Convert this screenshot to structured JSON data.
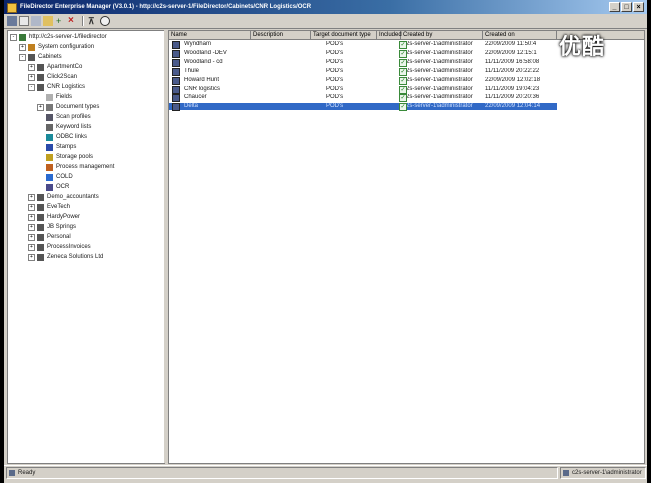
{
  "window": {
    "title": "FileDirector Enterprise Manager (V3.0.1) - http://c2s-server-1/FileDirector/Cabinets/CNR Logistics/OCR"
  },
  "watermark": "优酷",
  "tree": [
    {
      "id": "root",
      "label": "http://c2s-server-1/filedirector",
      "level": 0,
      "expander": "-",
      "icon": "server-icon",
      "color": "#3a7a3a"
    },
    {
      "id": "system-config",
      "label": "System configuration",
      "level": 1,
      "expander": "+",
      "icon": "config-icon",
      "color": "#c08020"
    },
    {
      "id": "cabinets",
      "label": "Cabinets",
      "level": 1,
      "expander": "-",
      "icon": "cabinet-icon",
      "color": "#555"
    },
    {
      "id": "apartmentco",
      "label": "ApartmentCo",
      "level": 2,
      "expander": "+",
      "icon": "cabinet-icon",
      "color": "#555"
    },
    {
      "id": "click2scan",
      "label": "Click2Scan",
      "level": 2,
      "expander": "+",
      "icon": "cabinet-icon",
      "color": "#555"
    },
    {
      "id": "cnr-logistics",
      "label": "CNR Logistics",
      "level": 2,
      "expander": "-",
      "icon": "cabinet-icon",
      "color": "#555"
    },
    {
      "id": "fields",
      "label": "Fields",
      "level": 3,
      "expander": "",
      "icon": "fields-icon",
      "color": "#b0b0b0"
    },
    {
      "id": "document-types",
      "label": "Document types",
      "level": 3,
      "expander": "+",
      "icon": "doctype-icon",
      "color": "#777"
    },
    {
      "id": "scan-profiles",
      "label": "Scan profiles",
      "level": 3,
      "expander": "",
      "icon": "scanner-icon",
      "color": "#556"
    },
    {
      "id": "keyword-lists",
      "label": "Keyword lists",
      "level": 3,
      "expander": "",
      "icon": "keyword-icon",
      "color": "#666"
    },
    {
      "id": "odbc-links",
      "label": "ODBC links",
      "level": 3,
      "expander": "",
      "icon": "odbc-icon",
      "color": "#1a8a9a"
    },
    {
      "id": "stamps",
      "label": "Stamps",
      "level": 3,
      "expander": "",
      "icon": "stamp-icon",
      "color": "#2a4aaa"
    },
    {
      "id": "storage-pools",
      "label": "Storage pools",
      "level": 3,
      "expander": "",
      "icon": "storage-icon",
      "color": "#c0a020"
    },
    {
      "id": "process-management",
      "label": "Process management",
      "level": 3,
      "expander": "",
      "icon": "process-icon",
      "color": "#c06020"
    },
    {
      "id": "cold",
      "label": "COLD",
      "level": 3,
      "expander": "",
      "icon": "cold-icon",
      "color": "#2a6ad0"
    },
    {
      "id": "ocr",
      "label": "OCR",
      "level": 3,
      "expander": "",
      "icon": "ocr-icon",
      "color": "#4a4a8a"
    },
    {
      "id": "demo-accountants",
      "label": "Demo_accountants",
      "level": 2,
      "expander": "+",
      "icon": "cabinet-icon",
      "color": "#555"
    },
    {
      "id": "evetech",
      "label": "EveTech",
      "level": 2,
      "expander": "+",
      "icon": "cabinet-icon",
      "color": "#555"
    },
    {
      "id": "hardypower",
      "label": "HardyPower",
      "level": 2,
      "expander": "+",
      "icon": "cabinet-icon",
      "color": "#555"
    },
    {
      "id": "jb-springs",
      "label": "JB Springs",
      "level": 2,
      "expander": "+",
      "icon": "cabinet-icon",
      "color": "#555"
    },
    {
      "id": "personal",
      "label": "Personal",
      "level": 2,
      "expander": "+",
      "icon": "cabinet-icon",
      "color": "#555"
    },
    {
      "id": "processinvoices",
      "label": "ProcessInvoices",
      "level": 2,
      "expander": "+",
      "icon": "cabinet-icon",
      "color": "#555"
    },
    {
      "id": "zeneca-solutions",
      "label": "Zeneca Solutions Ltd",
      "level": 2,
      "expander": "+",
      "icon": "cabinet-icon",
      "color": "#555"
    }
  ],
  "list": {
    "columns": [
      "Name",
      "Description",
      "Target document type",
      "Included",
      "Created by",
      "Created on"
    ],
    "rows": [
      {
        "name": "Wyndham",
        "description": "",
        "target": "POD's",
        "included": "✓",
        "created_by": "c2s-server-1\\administrator",
        "created_on": "22/09/2009 11:50:4",
        "selected": false
      },
      {
        "name": "Woodland -DEV",
        "description": "",
        "target": "POD's",
        "included": "✓",
        "created_by": "c2s-server-1\\administrator",
        "created_on": "22/09/2009 12:15:1",
        "selected": false
      },
      {
        "name": "Woodland - cd",
        "description": "",
        "target": "POD's",
        "included": "✓",
        "created_by": "c2s-server-1\\administrator",
        "created_on": "11/11/2009 16:58:08",
        "selected": false
      },
      {
        "name": "Thule",
        "description": "",
        "target": "POD's",
        "included": "✓",
        "created_by": "c2s-server-1\\administrator",
        "created_on": "11/11/2009 20:22:22",
        "selected": false
      },
      {
        "name": "Howard Hunt",
        "description": "",
        "target": "POD's",
        "included": "✓",
        "created_by": "c2s-server-1\\administrator",
        "created_on": "22/09/2009 12:02:18",
        "selected": false
      },
      {
        "name": "CNR logistics",
        "description": "",
        "target": "POD's",
        "included": "✓",
        "created_by": "c2s-server-1\\administrator",
        "created_on": "11/11/2009 19:04:23",
        "selected": false
      },
      {
        "name": "Chaucer",
        "description": "",
        "target": "POD's",
        "included": "✓",
        "created_by": "c2s-server-1\\administrator",
        "created_on": "11/11/2009 20:20:36",
        "selected": false
      },
      {
        "name": "Delta",
        "description": "",
        "target": "POD's",
        "included": "✓",
        "created_by": "c2s-server-1\\administrator",
        "created_on": "22/09/2009 12:04:14",
        "selected": true
      }
    ]
  },
  "status": {
    "left": "Ready",
    "right": "c2s-server-1\\administrator"
  },
  "colors": {
    "selection": "#3169c6",
    "titlebar": "#0a246a"
  }
}
